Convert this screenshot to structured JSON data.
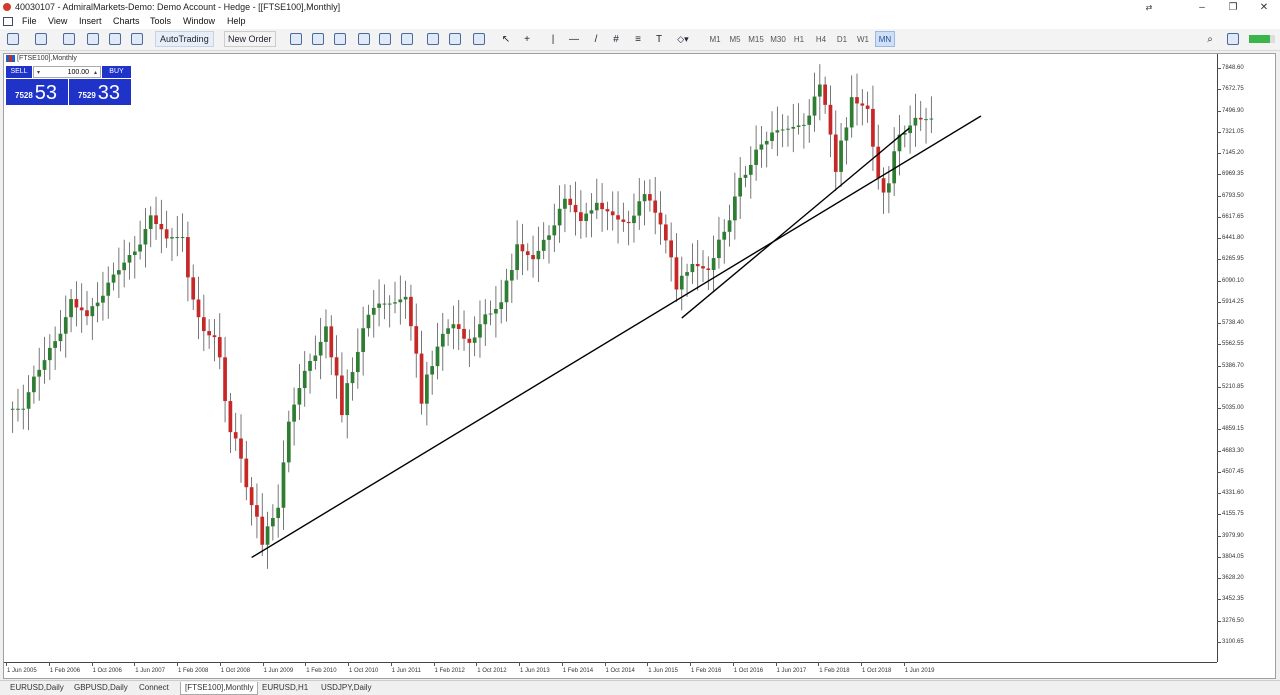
{
  "window": {
    "title": "40030107 - AdmiralMarkets-Demo: Demo Account - Hedge - [[FTSE100],Monthly]"
  },
  "menu": [
    "File",
    "View",
    "Insert",
    "Charts",
    "Tools",
    "Window",
    "Help"
  ],
  "toolbar": {
    "autotrading_label": "AutoTrading",
    "new_order_label": "New Order",
    "periods": [
      "M1",
      "M5",
      "M15",
      "M30",
      "H1",
      "H4",
      "D1",
      "W1",
      "MN"
    ],
    "active_period": "MN"
  },
  "chart": {
    "title": "[FTSE100],Monthly",
    "trade_panel": {
      "sell_label": "SELL",
      "buy_label": "BUY",
      "lot": "100.00",
      "sell_small": "7528",
      "sell_big": "53",
      "buy_small": "7529",
      "buy_big": "33"
    },
    "price_labels": [
      "7848.60",
      "7672.75",
      "7496.90",
      "7321.05",
      "7145.20",
      "6969.35",
      "6793.50",
      "6617.65",
      "6441.80",
      "6265.95",
      "6090.10",
      "5914.25",
      "5738.40",
      "5562.55",
      "5386.70",
      "5210.85",
      "5035.00",
      "4859.15",
      "4683.30",
      "4507.45",
      "4331.60",
      "4155.75",
      "3979.90",
      "3804.05",
      "3628.20",
      "3452.35",
      "3276.50",
      "3100.65"
    ],
    "time_labels": [
      "1 Jun 2005",
      "1 Feb 2006",
      "1 Oct 2006",
      "1 Jun 2007",
      "1 Feb 2008",
      "1 Oct 2008",
      "1 Jun 2009",
      "1 Feb 2010",
      "1 Oct 2010",
      "1 Jun 2011",
      "1 Feb 2012",
      "1 Oct 2012",
      "1 Jun 2013",
      "1 Feb 2014",
      "1 Oct 2014",
      "1 Jun 2015",
      "1 Feb 2016",
      "1 Oct 2016",
      "1 Jun 2017",
      "1 Feb 2018",
      "1 Oct 2018",
      "1 Jun 2019"
    ],
    "colors": {
      "bull": "#2e7d32",
      "bear": "#c62828",
      "trendline": "#000000"
    }
  },
  "chart_data": {
    "type": "candlestick",
    "symbol": "FTSE100",
    "timeframe": "Monthly",
    "ylim": [
      3100.65,
      7848.6
    ],
    "x": [
      "2005-06",
      "2005-09",
      "2005-12",
      "2006-03",
      "2006-06",
      "2006-09",
      "2006-12",
      "2007-03",
      "2007-06",
      "2007-09",
      "2007-12",
      "2008-03",
      "2008-06",
      "2008-09",
      "2008-12",
      "2009-03",
      "2009-06",
      "2009-09",
      "2009-12",
      "2010-03",
      "2010-06",
      "2010-09",
      "2010-12",
      "2011-03",
      "2011-06",
      "2011-09",
      "2011-12",
      "2012-03",
      "2012-06",
      "2012-09",
      "2012-12",
      "2013-03",
      "2013-06",
      "2013-09",
      "2013-12",
      "2014-03",
      "2014-06",
      "2014-09",
      "2014-12",
      "2015-03",
      "2015-06",
      "2015-09",
      "2015-12",
      "2016-03",
      "2016-06",
      "2016-09",
      "2016-12",
      "2017-03",
      "2017-06",
      "2017-09",
      "2017-12",
      "2018-03",
      "2018-06",
      "2018-09",
      "2018-12",
      "2019-03",
      "2019-06",
      "2019-09"
    ],
    "close": [
      5030,
      5380,
      5580,
      5900,
      5800,
      5980,
      6200,
      6330,
      6600,
      6450,
      6450,
      5700,
      5620,
      4900,
      4430,
      3900,
      4250,
      5130,
      5410,
      5680,
      5000,
      5550,
      5900,
      5900,
      5950,
      5130,
      5570,
      5750,
      5570,
      5790,
      5900,
      6400,
      6250,
      6480,
      6750,
      6600,
      6730,
      6620,
      6560,
      6800,
      6580,
      6050,
      6240,
      6170,
      6500,
      6900,
      7150,
      7320,
      7350,
      7380,
      7690,
      7060,
      7600,
      7500,
      6750,
      7280,
      7420,
      7430
    ],
    "trendlines": [
      {
        "from": [
          "2009-03",
          3800
        ],
        "to": [
          "2019-09",
          7150
        ]
      },
      {
        "from": [
          "2015-12",
          5780
        ],
        "to": [
          "2019-06",
          7320
        ]
      }
    ]
  },
  "tabs": [
    "EURUSD,Daily",
    "GBPUSD,Daily",
    "Connect",
    "[FTSE100],Monthly",
    "EURUSD,H1",
    "USDJPY,Daily"
  ],
  "active_tab": "[FTSE100],Monthly"
}
